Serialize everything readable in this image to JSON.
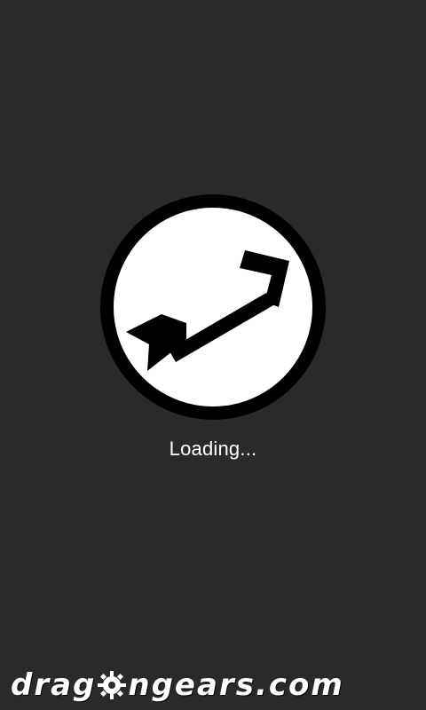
{
  "status": {
    "loading_text": "Loading..."
  },
  "brand": {
    "text": "dragongears.com",
    "text_before_gear": "drag",
    "text_after_gear": "ngears.com"
  },
  "colors": {
    "background": "#2a2a2a",
    "logo_ring": "#000000",
    "logo_fill": "#ffffff",
    "arrow": "#000000",
    "text": "#ffffff"
  },
  "icons": {
    "app_logo": "arrow-in-circle-icon",
    "gear": "gear-icon"
  }
}
